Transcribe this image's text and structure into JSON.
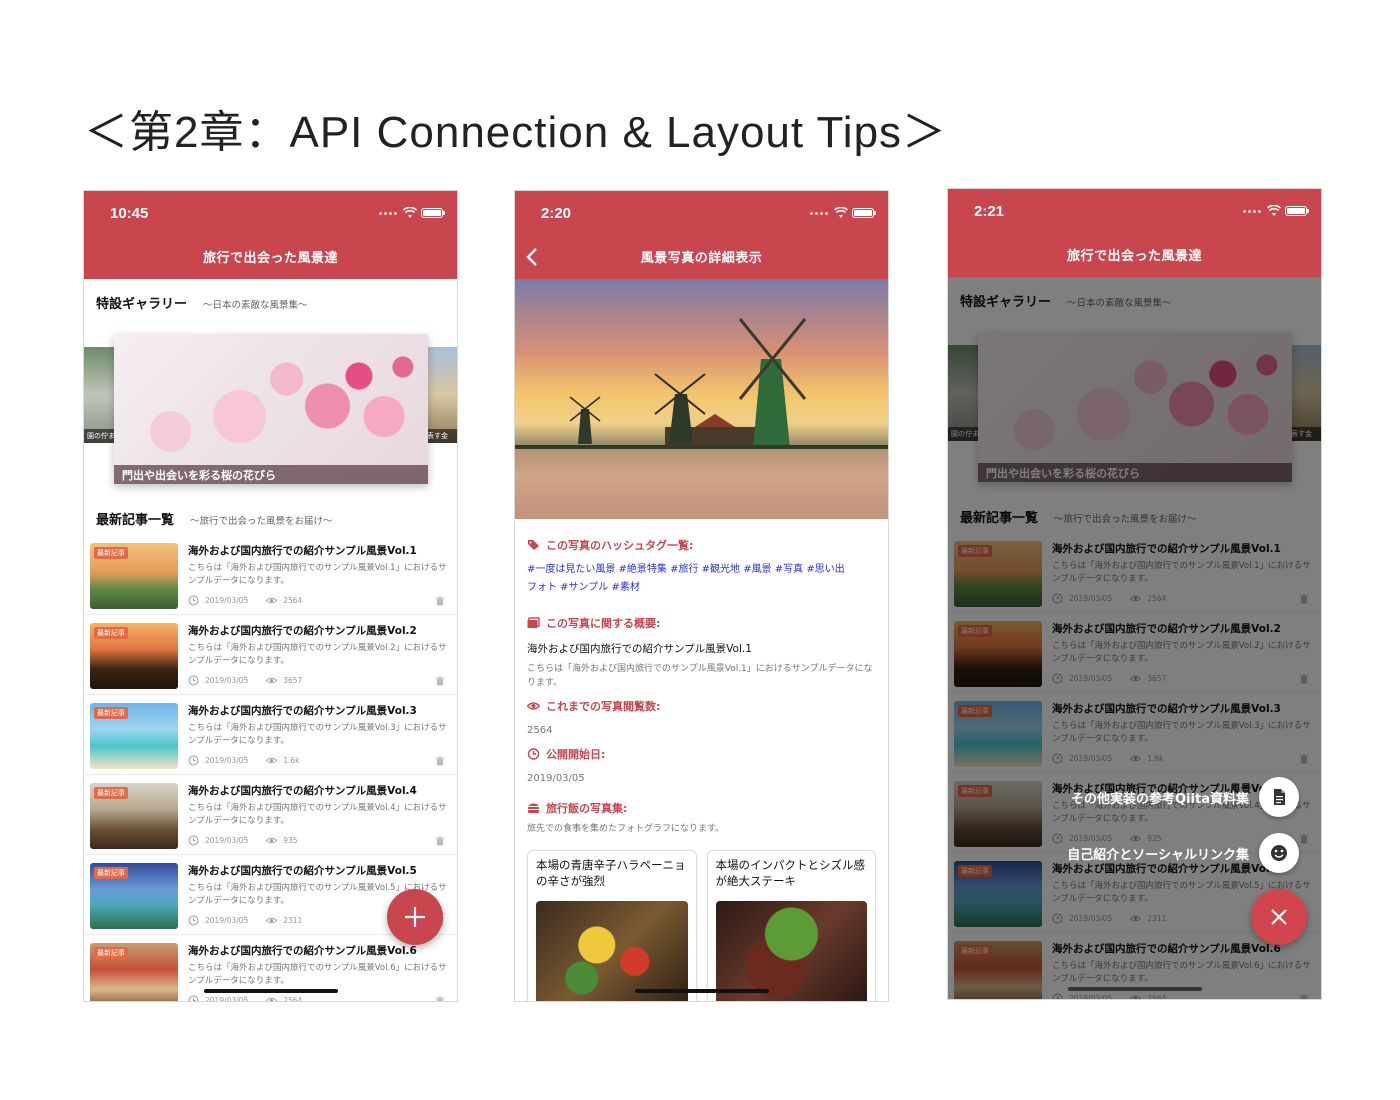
{
  "page_heading": "＜第2章：API Connection & Layout Tips＞",
  "phone1": {
    "status_time": "10:45",
    "title": "旅行で出会った風景達",
    "gallery_title": "特設ギャラリー",
    "gallery_sub": "〜日本の素敵な風景集〜",
    "gallery_main_caption": "門出や出会いを彩る桜の花びら",
    "gallery_left_caption": "園の佇ま",
    "gallery_right_caption": "を表す金",
    "latest_title": "最新記事一覧",
    "latest_sub": "〜旅行で出会った風景をお届け〜",
    "badge": "最新記事",
    "articles": [
      {
        "title": "海外および国内旅行での紹介サンプル風景Vol.1",
        "desc": "こちらは「海外および国内旅行でのサンプル風景Vol.1」におけるサンプルデータになります。",
        "date": "2019/03/05",
        "views": "2564"
      },
      {
        "title": "海外および国内旅行での紹介サンプル風景Vol.2",
        "desc": "こちらは「海外および国内旅行でのサンプル風景Vol.2」におけるサンプルデータになります。",
        "date": "2019/03/05",
        "views": "3657"
      },
      {
        "title": "海外および国内旅行での紹介サンプル風景Vol.3",
        "desc": "こちらは「海外および国内旅行でのサンプル風景Vol.3」におけるサンプルデータになります。",
        "date": "2019/03/05",
        "views": "1.6k"
      },
      {
        "title": "海外および国内旅行での紹介サンプル風景Vol.4",
        "desc": "こちらは「海外および国内旅行でのサンプル風景Vol.4」におけるサンプルデータになります。",
        "date": "2019/03/05",
        "views": "935"
      },
      {
        "title": "海外および国内旅行での紹介サンプル風景Vol.5",
        "desc": "こちらは「海外および国内旅行でのサンプル風景Vol.5」におけるサンプルデータになります。",
        "date": "2019/03/05",
        "views": "2311"
      },
      {
        "title": "海外および国内旅行での紹介サンプル風景Vol.6",
        "desc": "こちらは「海外および国内旅行でのサンプル風景Vol.6」におけるサンプルデータになります。",
        "date": "2019/03/05",
        "views": "2564"
      }
    ],
    "fab_icon": "plus-icon"
  },
  "phone2": {
    "status_time": "2:20",
    "title": "風景写真の詳細表示",
    "hashtag_label": "この写真のハッシュタグ一覧:",
    "hashtags_line1": "#一度は見たい風景 #絶景特集 #旅行 #観光地 #風景 #写真 #思い出",
    "hashtags_line2": "フォト #サンプル #素材",
    "summary_label": "この写真に関する概要:",
    "summary_title": "海外および国内旅行での紹介サンプル風景Vol.1",
    "summary_text": "こちらは「海外および国内旅行でのサンプル風景Vol.1」におけるサンプルデータになります。",
    "views_label": "これまでの写真閲覧数:",
    "views_value": "2564",
    "date_label": "公開開始日:",
    "date_value": "2019/03/05",
    "food_label": "旅行飯の写真集:",
    "food_text": "旅先での食事を集めたフォトグラフになります。",
    "food_cards": [
      {
        "title": "本場の青唐辛子ハラペーニョの辛さが強烈"
      },
      {
        "title": "本場のインパクトとシズル感が絶大ステーキ"
      }
    ]
  },
  "phone3": {
    "status_time": "2:21",
    "title": "旅行で出会った風景達",
    "menu_item1": "その他実装の参考Qiita資料集",
    "menu_item2": "自己紹介とソーシャルリンク集",
    "fab_icon": "close-icon"
  },
  "colors": {
    "accent": "#c9464f",
    "tag_link": "#2b2ef0",
    "badge": "#e36a45"
  }
}
